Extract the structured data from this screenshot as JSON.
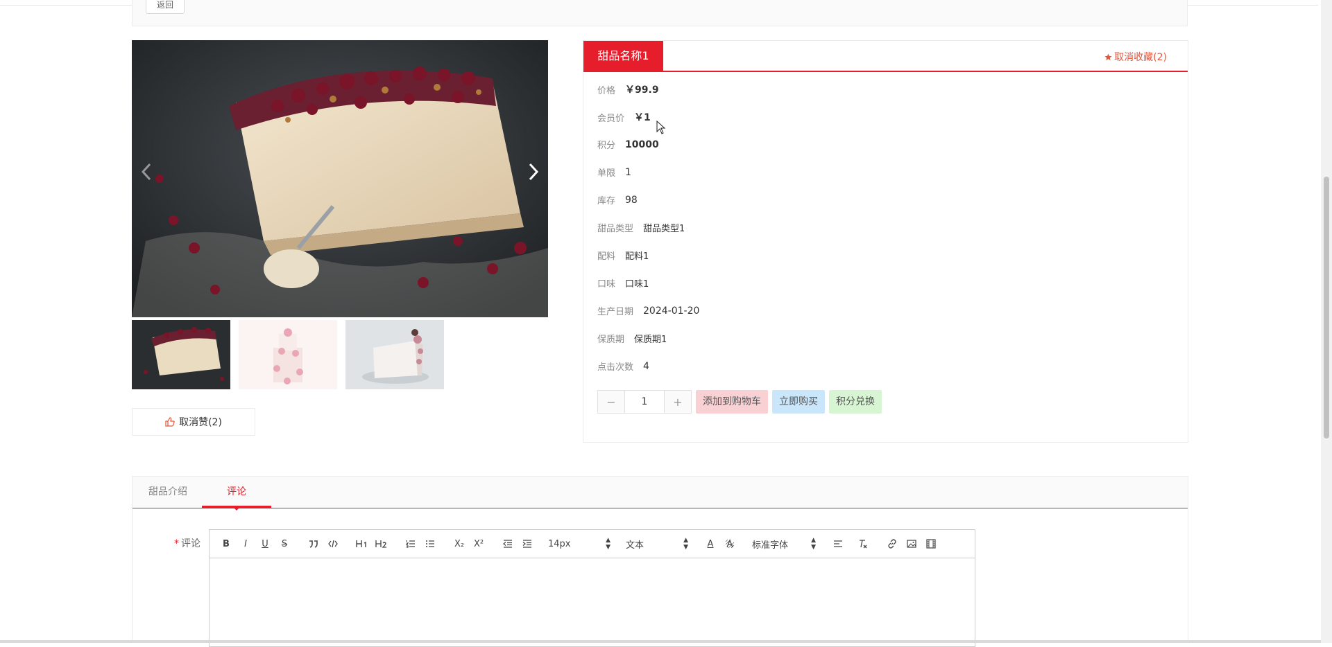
{
  "header": {
    "back_label": "返回"
  },
  "gallery": {
    "arrow_left": "‹",
    "arrow_right": "›",
    "thumbs": [
      "thumb-1",
      "thumb-2",
      "thumb-3"
    ]
  },
  "like": {
    "label": "取消赞(2)"
  },
  "product": {
    "title": "甜品名称1",
    "favorite_label": "取消收藏(2)",
    "fields": [
      {
        "label": "价格",
        "value": "￥99.9"
      },
      {
        "label": "会员价",
        "value": "￥1"
      },
      {
        "label": "积分",
        "value": "10000"
      },
      {
        "label": "单限",
        "value": "1"
      },
      {
        "label": "库存",
        "value": "98"
      },
      {
        "label": "甜品类型",
        "value": "甜品类型1"
      },
      {
        "label": "配料",
        "value": "配料1"
      },
      {
        "label": "口味",
        "value": "口味1"
      },
      {
        "label": "生产日期",
        "value": "2024-01-20"
      },
      {
        "label": "保质期",
        "value": "保质期1"
      },
      {
        "label": "点击次数",
        "value": "4"
      }
    ],
    "quantity": "1",
    "minus": "−",
    "plus": "+",
    "add_to_cart": "添加到购物车",
    "buy_now": "立即购买",
    "points_exchange": "积分兑换"
  },
  "tabs": {
    "items": [
      {
        "label": "甜品介绍"
      },
      {
        "label": "评论"
      }
    ]
  },
  "comment": {
    "required_mark": "*",
    "label": "评论",
    "toolbar": {
      "bold": "B",
      "italic": "I",
      "underline": "U",
      "strike": "S",
      "quote": "99",
      "code": "</>",
      "h1": "H1",
      "h2": "H2",
      "ol": "ol",
      "ul": "ul",
      "sub": "X₂",
      "sup": "X²",
      "outdent": "out",
      "indent": "in",
      "size": "14px",
      "header": "文本",
      "color": "A",
      "background": "bg",
      "font": "标准字体",
      "align": "align",
      "clean": "Tx",
      "link": "link",
      "image": "img",
      "video": "vid"
    }
  }
}
